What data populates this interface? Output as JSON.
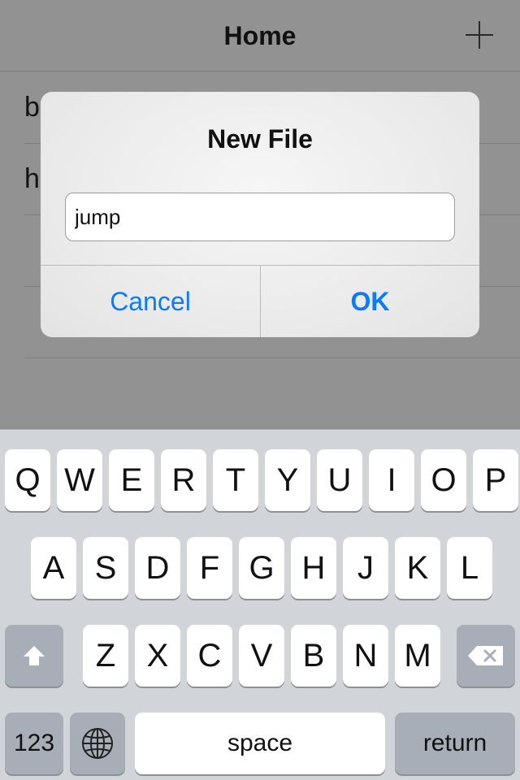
{
  "nav": {
    "title": "Home"
  },
  "list": {
    "items": [
      "b",
      "h"
    ]
  },
  "alert": {
    "title": "New File",
    "input_value": "jump",
    "cancel_label": "Cancel",
    "ok_label": "OK"
  },
  "keyboard": {
    "row1": [
      "Q",
      "W",
      "E",
      "R",
      "T",
      "Y",
      "U",
      "I",
      "O",
      "P"
    ],
    "row2": [
      "A",
      "S",
      "D",
      "F",
      "G",
      "H",
      "J",
      "K",
      "L"
    ],
    "row3": [
      "Z",
      "X",
      "C",
      "V",
      "B",
      "N",
      "M"
    ],
    "numbers_label": "123",
    "space_label": "space",
    "return_label": "return"
  },
  "colors": {
    "accent": "#0a7aff",
    "dim_overlay": "#929292",
    "keyboard_bg": "#d1d4d9"
  }
}
